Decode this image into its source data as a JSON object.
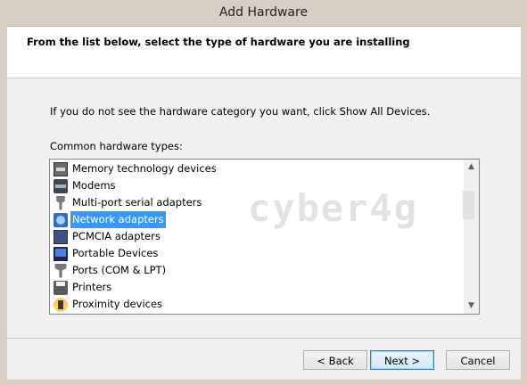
{
  "window": {
    "title": "Add Hardware"
  },
  "header": {
    "text": "From the list below, select the type of hardware you are installing"
  },
  "body": {
    "instruction": "If you do not see the hardware category you want, click Show All Devices.",
    "list_label": "Common hardware types:"
  },
  "list": {
    "items": [
      {
        "label": "Memory technology devices",
        "icon": "memory-icon",
        "selected": false
      },
      {
        "label": "Modems",
        "icon": "modem-icon",
        "selected": false
      },
      {
        "label": "Multi-port serial adapters",
        "icon": "serial-adapter-icon",
        "selected": false
      },
      {
        "label": "Network adapters",
        "icon": "network-adapter-icon",
        "selected": true
      },
      {
        "label": "PCMCIA adapters",
        "icon": "pcmcia-icon",
        "selected": false
      },
      {
        "label": "Portable Devices",
        "icon": "portable-device-icon",
        "selected": false
      },
      {
        "label": "Ports (COM & LPT)",
        "icon": "port-icon",
        "selected": false
      },
      {
        "label": "Printers",
        "icon": "printer-icon",
        "selected": false
      },
      {
        "label": "Proximity devices",
        "icon": "proximity-icon",
        "selected": false
      }
    ]
  },
  "watermark": {
    "text": "cyber4g"
  },
  "buttons": {
    "back": "< Back",
    "next": "Next >",
    "cancel": "Cancel"
  },
  "colors": {
    "selection": "#3399ff",
    "title_bar": "#d8cec4"
  }
}
